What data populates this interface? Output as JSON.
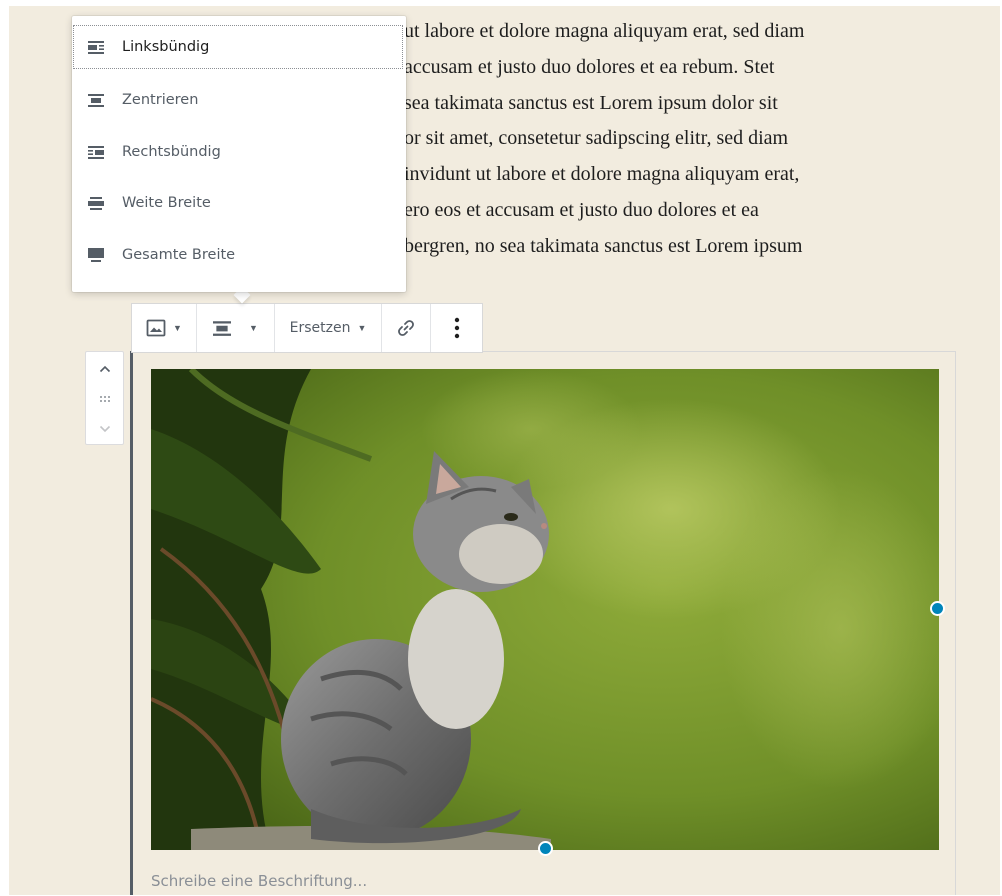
{
  "paragraph": {
    "lines": [
      "ut labore et dolore magna aliquyam erat, sed diam",
      "accusam et justo duo dolores et ea rebum. Stet",
      "sea takimata sanctus est Lorem ipsum dolor sit",
      "or sit amet, consetetur sadipscing elitr, sed diam",
      "invidunt ut labore et dolore magna aliquyam erat,",
      "ero eos et accusam et justo duo dolores et ea",
      "bergren, no sea takimata sanctus est Lorem ipsum"
    ]
  },
  "align_menu": {
    "items": [
      {
        "label": "Linksbündig",
        "icon": "align-left-icon",
        "selected": true
      },
      {
        "label": "Zentrieren",
        "icon": "align-center-icon",
        "selected": false
      },
      {
        "label": "Rechtsbündig",
        "icon": "align-right-icon",
        "selected": false
      },
      {
        "label": "Weite Breite",
        "icon": "align-wide-icon",
        "selected": false
      },
      {
        "label": "Gesamte Breite",
        "icon": "align-full-icon",
        "selected": false
      }
    ]
  },
  "toolbar": {
    "block_type_icon": "image-icon",
    "align_icon": "align-center-icon",
    "replace_label": "Ersetzen",
    "link_icon": "link-icon",
    "more_icon": "more-vertical-icon"
  },
  "mover": {
    "up_icon": "chevron-up-icon",
    "drag_icon": "drag-handle-icon",
    "down_icon": "chevron-down-icon"
  },
  "image": {
    "subject": "grey tabby kitten sitting on a branch, looking up, green blurred background"
  },
  "caption": {
    "placeholder": "Schreibe eine Beschriftung..."
  },
  "colors": {
    "canvas_background": "#f2ecdf",
    "accent": "#0085ba",
    "icon": "#555d66",
    "block_border": "#555d66"
  }
}
